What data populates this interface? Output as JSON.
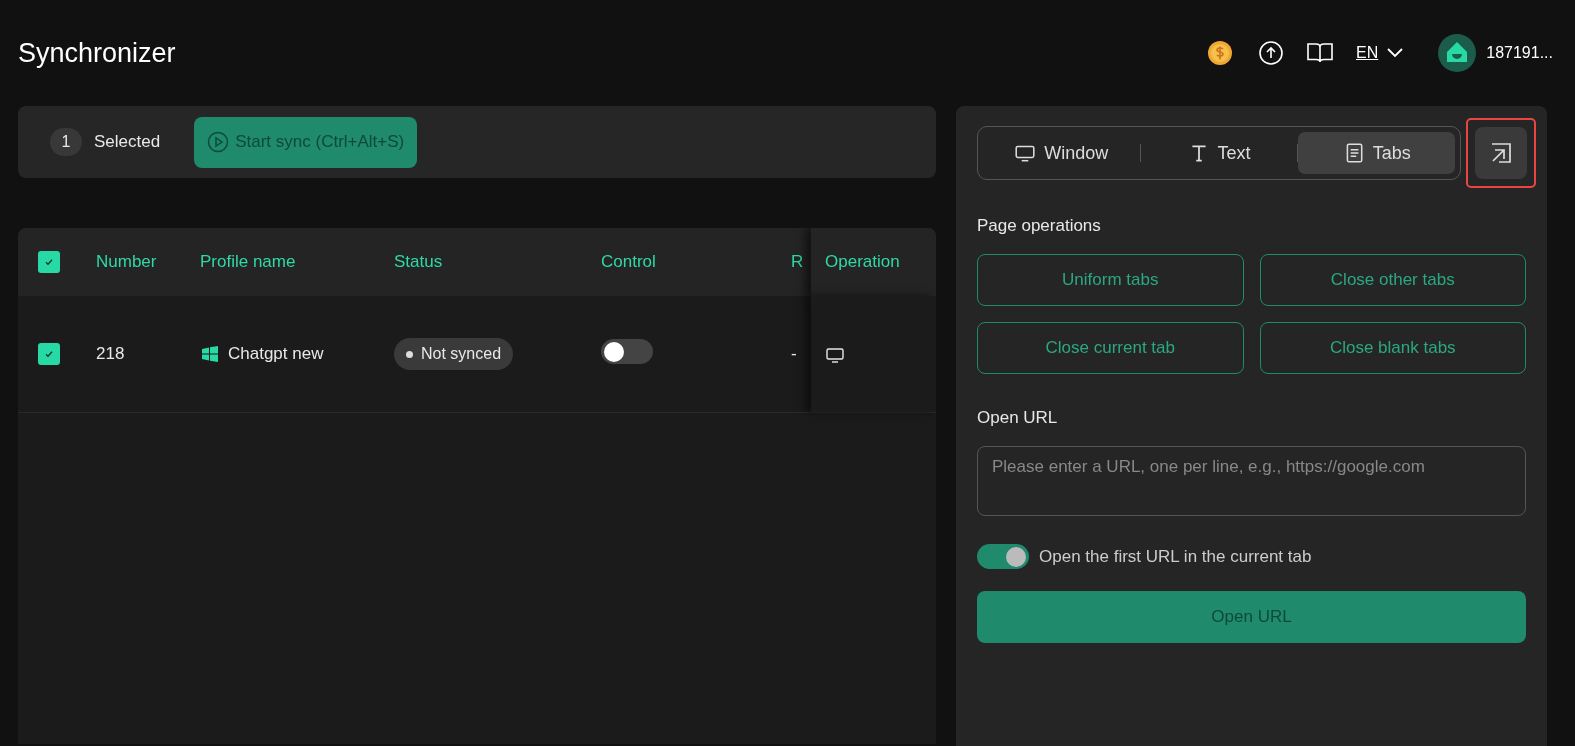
{
  "window": {
    "title": "Synchronizer"
  },
  "header": {
    "language": "EN",
    "user": "187191..."
  },
  "toolbar": {
    "selected_count": "1",
    "selected_label": "Selected",
    "start_button": "Start sync (Ctrl+Alt+S)"
  },
  "table": {
    "all_checked": true,
    "columns": [
      "Number",
      "Profile name",
      "Status",
      "Control",
      "R",
      "Operation"
    ],
    "rows": [
      {
        "checked": true,
        "number": "218",
        "profile": "Chatgpt new",
        "status": "Not synced",
        "control_on": false,
        "column_5": "-"
      }
    ]
  },
  "panel": {
    "tabs": [
      {
        "label": "Window",
        "selected": false
      },
      {
        "label": "Text",
        "selected": false
      },
      {
        "label": "Tabs",
        "selected": true
      }
    ],
    "popout_highlighted": true,
    "page_operations_title": "Page operations",
    "operations": [
      "Uniform tabs",
      "Close other tabs",
      "Close current tab",
      "Close blank tabs"
    ],
    "open_url_title": "Open URL",
    "url_placeholder": "Please enter a URL, one per line, e.g., https://google.com",
    "first_url_toggle": {
      "on": true,
      "label": "Open the first URL in the current tab"
    },
    "open_button": "Open URL"
  }
}
